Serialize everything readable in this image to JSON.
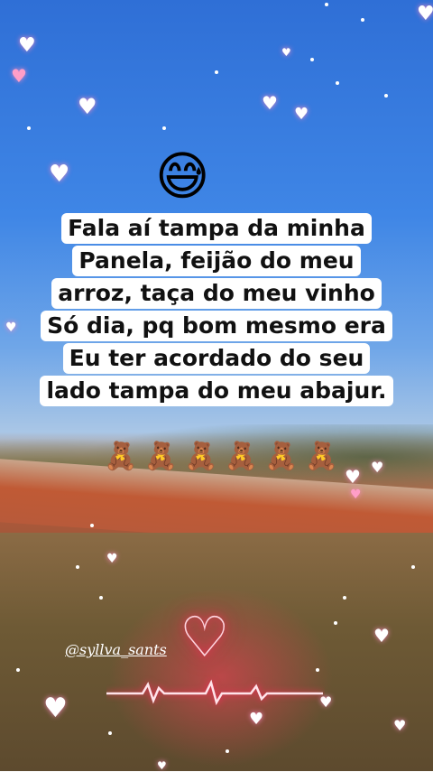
{
  "emoji": "😅",
  "message_lines": [
    "Fala aí tampa da minha",
    "Panela, feijão do meu",
    "arroz, taça do meu vinho",
    "Só dia, pq bom mesmo era",
    "Eu ter acordado do seu",
    "lado tampa do meu abajur."
  ],
  "bears": [
    "🧸",
    "🧸",
    "🧸",
    "🧸",
    "🧸",
    "🧸"
  ],
  "handle": "@syllva_sants",
  "icons": {
    "center": "neon-heart-icon",
    "wave": "heartbeat-line-icon",
    "sparkles": "heart-icon"
  },
  "colors": {
    "sky": "#3f86e6",
    "soil": "#b0573a",
    "neon": "#ff2a5a",
    "text_bg": "#ffffff"
  }
}
